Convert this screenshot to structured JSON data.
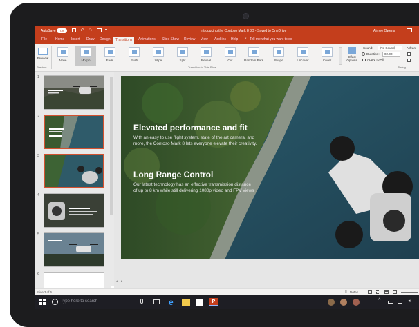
{
  "titlebar": {
    "autosave_label": "AutoSave",
    "autosave_state": "On",
    "document_title": "Introducing the Contoso Mark 8 3D - Saved to OneDrive",
    "user_name": "Aimee Owens"
  },
  "ribbon_tabs": [
    "File",
    "Home",
    "Insert",
    "Draw",
    "Design",
    "Transitions",
    "Animations",
    "Slide Show",
    "Review",
    "View",
    "Add-ins",
    "Help"
  ],
  "active_tab": "Transitions",
  "tell_me": "Tell me what you want to do",
  "preview": {
    "button": "Preview",
    "group": "Preview"
  },
  "transitions": [
    "None",
    "Morph",
    "Fade",
    "Push",
    "Wipe",
    "Split",
    "Reveal",
    "Cut",
    "Random Bars",
    "Shape",
    "Uncover",
    "Cover"
  ],
  "selected_transition": "Morph",
  "transitions_group": "Transition to This Slide",
  "effect_options": "Effect Options",
  "timing": {
    "sound_label": "Sound:",
    "sound_value": "[No Sound]",
    "duration_label": "Duration:",
    "duration_value": "02.00",
    "apply_all": "Apply To All",
    "advance": "Advan",
    "group": "Timing"
  },
  "slides": [
    "1",
    "2",
    "3",
    "4",
    "5",
    "6"
  ],
  "selected_slide": 3,
  "slide": {
    "heading1": "Elevated performance and fit",
    "body1_line1": "With an easy to use flight system, state of the art camera, and",
    "body1_line2": "more, the Contoso Mark 8 lets everyone elevate their creativity.",
    "heading2": "Long Range Control",
    "body2_line1": "Our latest technology has an effective transmission distance",
    "body2_line2": "of up to 8 km while still delivering 1080p video and FPV views"
  },
  "status": {
    "slide_counter": "Slide 3 of 6",
    "notes": "Notes"
  },
  "taskbar": {
    "search_placeholder": "Type here to search"
  },
  "colors": {
    "ppt_accent": "#c43e1c",
    "selected_thumb_border": "#d35230",
    "taskbar": "#1e1e24"
  }
}
